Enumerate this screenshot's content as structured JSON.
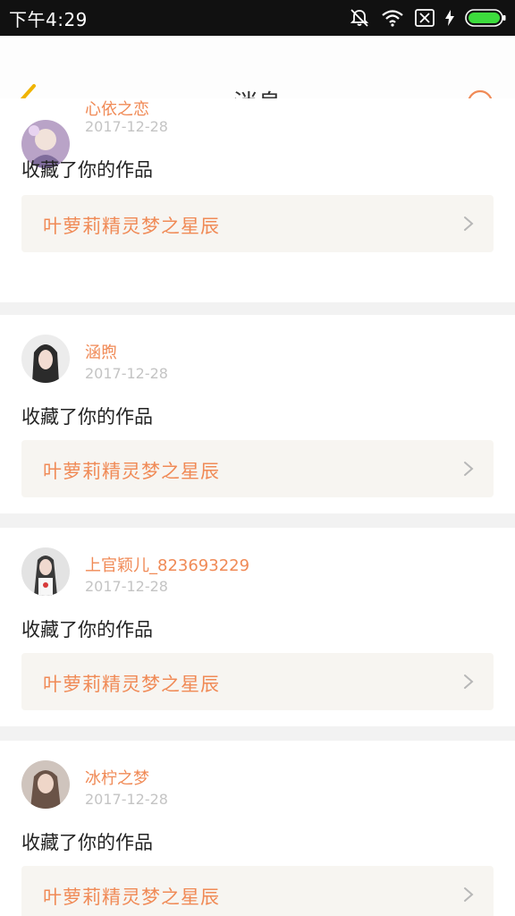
{
  "status_bar": {
    "time": "下午4:29",
    "icons": [
      "mute-icon",
      "wifi-icon",
      "no-sim-icon",
      "charging-icon",
      "battery-icon"
    ]
  },
  "header": {
    "title": "消息",
    "back_icon": "chevron-left-icon",
    "search_icon": "search-icon"
  },
  "colors": {
    "accent": "#f08a56",
    "back_icon": "#f0b400",
    "card_background": "#ffffff",
    "page_background": "#f2f2f2",
    "work_background": "#f7f5f1"
  },
  "messages": [
    {
      "user": "心依之恋",
      "date": "2017-12-28",
      "text": "收藏了你的作品",
      "work": "叶萝莉精灵梦之星辰"
    },
    {
      "user": "涵煦",
      "date": "2017-12-28",
      "text": "收藏了你的作品",
      "work": "叶萝莉精灵梦之星辰"
    },
    {
      "user": "上官颖儿_823693229",
      "date": "2017-12-28",
      "text": "收藏了你的作品",
      "work": "叶萝莉精灵梦之星辰"
    },
    {
      "user": "冰柠之梦",
      "date": "2017-12-28",
      "text": "收藏了你的作品",
      "work": "叶萝莉精灵梦之星辰"
    }
  ]
}
